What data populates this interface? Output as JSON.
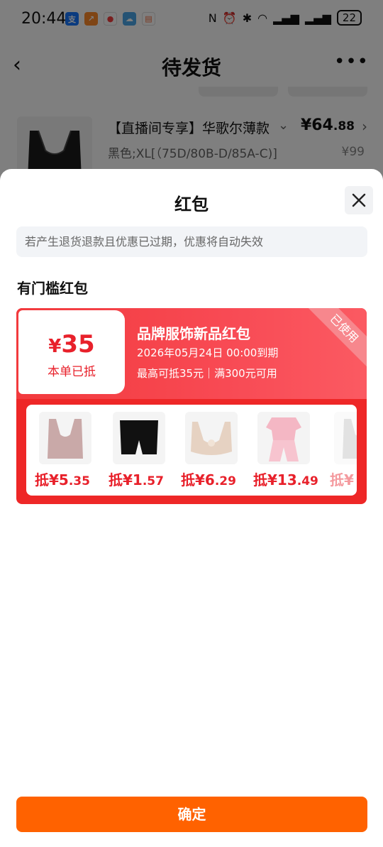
{
  "status_bar": {
    "time": "20:44",
    "battery": "22",
    "apps": [
      {
        "name": "alipay-icon",
        "color": "#1677ff",
        "glyph": "支"
      },
      {
        "name": "orange-app-icon",
        "color": "#ff8a2b",
        "glyph": "↗"
      },
      {
        "name": "map-icon",
        "color": "#f23c3c",
        "glyph": "●"
      },
      {
        "name": "weather-icon",
        "color": "#4aa7e8",
        "glyph": "☁"
      },
      {
        "name": "calendar-icon",
        "color": "#f26b3a",
        "glyph": "▤"
      }
    ]
  },
  "nav": {
    "title": "待发货",
    "back_glyph": "‹",
    "more_glyph": "•••"
  },
  "product": {
    "name": "【直播间专享】华歌尔薄款",
    "chevron": "⌄",
    "price_int": "¥64",
    "price_dec": ".88",
    "price_chevron": "›",
    "sku": "黑色;XL[（75D/80B-D/85A-C)]",
    "original_price": "¥99"
  },
  "sheet": {
    "title": "红包",
    "close_glyph": "×",
    "notice": "若产生退货退款且优惠已过期，优惠将自动失效",
    "section_title": "有门槛红包",
    "coupon": {
      "yen": "¥",
      "amount": "35",
      "used_label": "本单已抵",
      "name": "品牌服饰新品红包",
      "expire": "2026年05月24日 00:00到期",
      "rule": "最高可抵35元｜满300元可用",
      "ribbon": "已使用",
      "colors": {
        "accent": "#ee2727",
        "text": "#e8212b"
      }
    },
    "products": [
      {
        "label": "抵¥",
        "int": "5",
        "dec": ".35"
      },
      {
        "label": "抵¥",
        "int": "1",
        "dec": ".57"
      },
      {
        "label": "抵¥",
        "int": "6",
        "dec": ".29"
      },
      {
        "label": "抵¥",
        "int": "13",
        "dec": ".49"
      },
      {
        "label": "抵¥",
        "int": "",
        "dec": ""
      }
    ],
    "confirm_label": "确定",
    "confirm_color": "#ff6200"
  }
}
